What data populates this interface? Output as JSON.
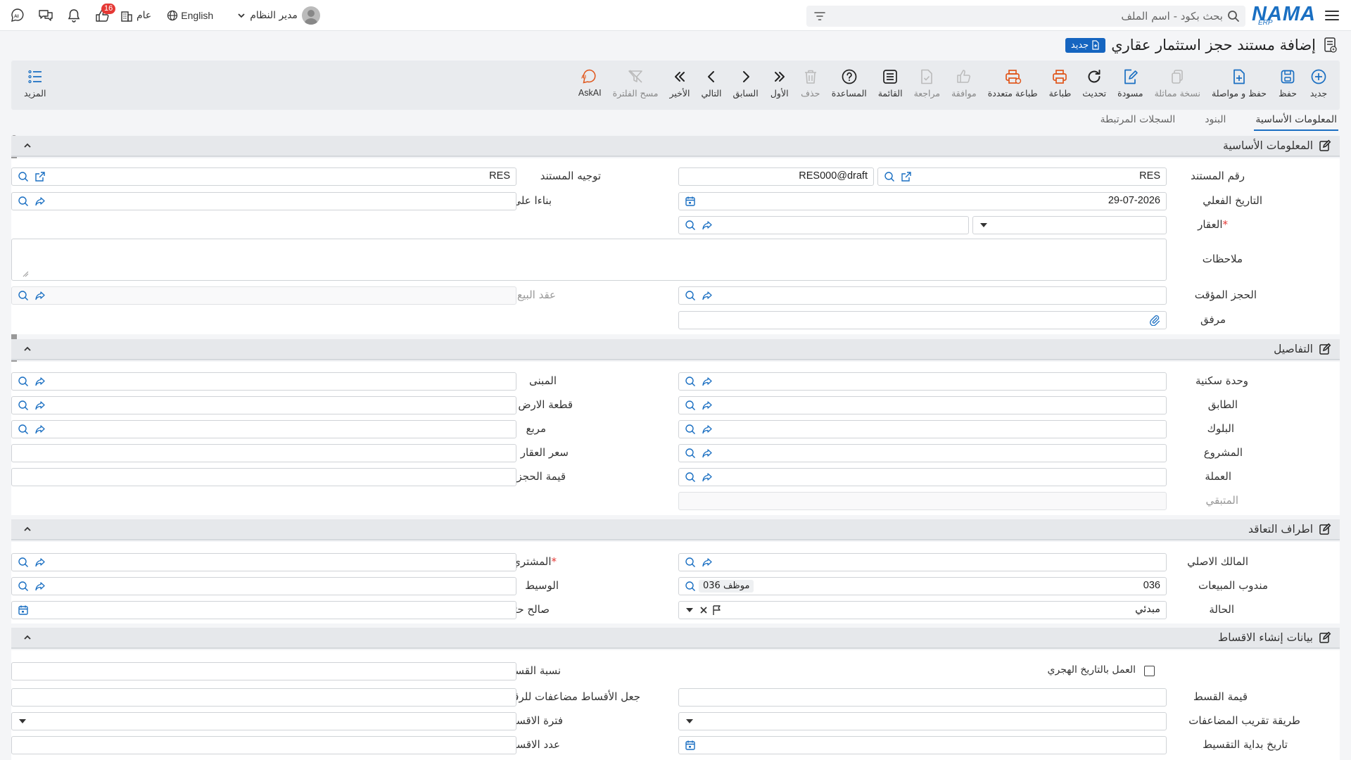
{
  "topbar": {
    "logo_text": "NAMA",
    "logo_sub": "ERP",
    "search_placeholder": "بحث بكود - اسم الملف",
    "user_name": "مدير النظام",
    "language": "English",
    "scope": "عام",
    "notification_count": "16"
  },
  "page": {
    "title": "إضافة مستند حجز استثمار عقاري",
    "new_badge": "جديد"
  },
  "toolbar": {
    "new": "جديد",
    "save": "حفظ",
    "save_continue": "حفظ و مواصلة",
    "duplicate": "نسخة مماثلة",
    "draft": "مسودة",
    "refresh": "تحديث",
    "print": "طباعة",
    "multi_print": "طباعة متعددة",
    "approve": "موافقة",
    "review": "مراجعة",
    "list": "القائمة",
    "help": "المساعدة",
    "delete": "حذف",
    "first": "الأول",
    "previous": "السابق",
    "next": "التالي",
    "last": "الأخير",
    "clear_filter": "مسح الفلترة",
    "askai": "AskAI",
    "more": "المزيد"
  },
  "tabs": [
    "المعلومات الأساسية",
    "البنود",
    "السجلات المرتبطة"
  ],
  "sections": {
    "basic": "المعلومات الأساسية",
    "details": "التفاصيل",
    "parties": "اطراف التعاقد",
    "installments": "بيانات إنشاء الاقساط"
  },
  "basic": {
    "doc_number_label": "رقم المستند",
    "doc_prefix": "RES",
    "doc_number": "RES000@draft",
    "doc_direction_label": "توجيه المستند",
    "doc_direction_value": "RES",
    "actual_date_label": "التاريخ الفعلي",
    "actual_date": "29-07-2026",
    "based_on_label": "بناءا على",
    "property_label": "العقار",
    "notes_label": "ملاحظات",
    "temp_reservation_label": "الحجز المؤقت",
    "sale_contract_label": "عقد البيع",
    "attachment_label": "مرفق"
  },
  "details": {
    "unit_label": "وحدة سكنية",
    "building_label": "المبنى",
    "floor_label": "الطابق",
    "land_label": "قطعة الارض",
    "block_label": "البلوك",
    "square_label": "مربع",
    "project_label": "المشروع",
    "price_label": "سعر العقار",
    "currency_label": "العملة",
    "reservation_value_label": "قيمة الحجز",
    "remaining_label": "المتبقي"
  },
  "parties": {
    "original_owner_label": "المالك الاصلي",
    "buyer_label": "المشتري",
    "sales_rep_label": "مندوب المبيعات",
    "sales_rep_code": "036",
    "sales_rep_name": "موظف 036",
    "broker_label": "الوسيط",
    "status_label": "الحالة",
    "status_value": "مبدئي",
    "valid_until_label": "صالح حتي"
  },
  "installments": {
    "hijri_label": "العمل بالتاريخ الهجري",
    "installment_ratio_label": "نسبة القسط",
    "installment_value_label": "قيمة القسط",
    "multiples_label": "جعل الأقساط مضاعفات للرقم",
    "rounding_method_label": "طريقة تقريب المضاعفات",
    "period_label": "فترة الاقساط",
    "start_date_label": "تاريخ بداية التقسيط",
    "count_label": "عدد الاقساط"
  },
  "colors": {
    "accent": "#1a6fc2",
    "print_orange": "#e0561b",
    "badge_red": "#e53935",
    "required": "#e53935"
  }
}
